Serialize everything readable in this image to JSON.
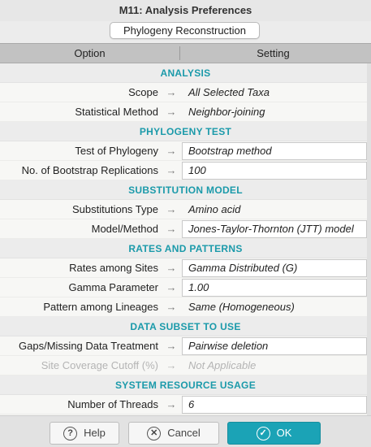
{
  "window": {
    "title": "M11: Analysis Preferences"
  },
  "tabs": [
    {
      "label": "Phylogeny Reconstruction"
    }
  ],
  "table": {
    "headers": {
      "option": "Option",
      "setting": "Setting"
    },
    "arrow_glyph": "→",
    "sections": [
      {
        "title": "ANALYSIS",
        "rows": [
          {
            "label": "Scope",
            "value": "All Selected Taxa",
            "editable": false,
            "disabled": false
          },
          {
            "label": "Statistical Method",
            "value": "Neighbor-joining",
            "editable": false,
            "disabled": false
          }
        ]
      },
      {
        "title": "PHYLOGENY TEST",
        "rows": [
          {
            "label": "Test of Phylogeny",
            "value": "Bootstrap method",
            "editable": true,
            "disabled": false
          },
          {
            "label": "No. of Bootstrap Replications",
            "value": "100",
            "editable": true,
            "disabled": false
          }
        ]
      },
      {
        "title": "SUBSTITUTION MODEL",
        "rows": [
          {
            "label": "Substitutions Type",
            "value": "Amino acid",
            "editable": false,
            "disabled": false
          },
          {
            "label": "Model/Method",
            "value": "Jones-Taylor-Thornton (JTT) model",
            "editable": true,
            "disabled": false
          }
        ]
      },
      {
        "title": "RATES AND PATTERNS",
        "rows": [
          {
            "label": "Rates among Sites",
            "value": "Gamma Distributed (G)",
            "editable": true,
            "disabled": false
          },
          {
            "label": "Gamma Parameter",
            "value": "1.00",
            "editable": true,
            "disabled": false
          },
          {
            "label": "Pattern among Lineages",
            "value": "Same (Homogeneous)",
            "editable": false,
            "disabled": false
          }
        ]
      },
      {
        "title": "DATA SUBSET TO USE",
        "rows": [
          {
            "label": "Gaps/Missing Data Treatment",
            "value": "Pairwise deletion",
            "editable": true,
            "disabled": false
          },
          {
            "label": "Site Coverage Cutoff (%)",
            "value": "Not Applicable",
            "editable": false,
            "disabled": true
          }
        ]
      },
      {
        "title": "SYSTEM RESOURCE USAGE",
        "rows": [
          {
            "label": "Number of Threads",
            "value": "6",
            "editable": true,
            "disabled": false
          }
        ]
      }
    ]
  },
  "footer": {
    "help": {
      "label": "Help",
      "icon": "question-icon",
      "glyph": "?"
    },
    "cancel": {
      "label": "Cancel",
      "icon": "x-circle-icon",
      "glyph": "✕"
    },
    "ok": {
      "label": "OK",
      "icon": "check-circle-icon",
      "glyph": "✓"
    }
  },
  "colors": {
    "accent": "#1ba3b6",
    "section_title": "#1b9aaa"
  }
}
